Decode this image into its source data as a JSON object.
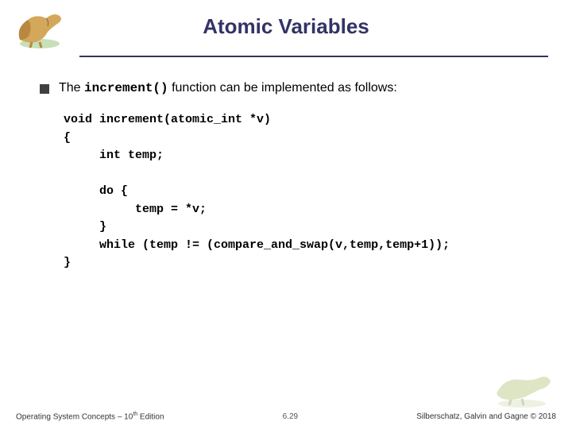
{
  "title": "Atomic Variables",
  "bullet": {
    "prefix": "The ",
    "code": "increment()",
    "suffix": " function can be implemented as follows:"
  },
  "code": "void increment(atomic_int *v)\n{\n     int temp;\n\n     do {\n          temp = *v;\n     }\n     while (temp != (compare_and_swap(v,temp,temp+1));\n}",
  "footer": {
    "left_a": "Operating System Concepts – 10",
    "left_sup": "th",
    "left_b": " Edition",
    "center": "6.29",
    "right": "Silberschatz, Galvin and Gagne © 2018"
  }
}
